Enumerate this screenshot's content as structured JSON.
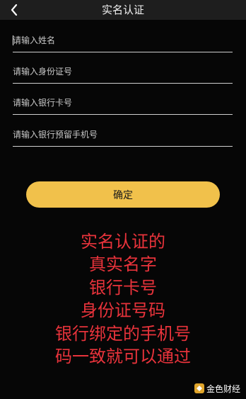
{
  "header": {
    "title": "实名认证"
  },
  "form": {
    "fields": [
      {
        "placeholder": "请输入姓名",
        "value": ""
      },
      {
        "placeholder": "请输入身份证号",
        "value": ""
      },
      {
        "placeholder": "请输入银行卡号",
        "value": ""
      },
      {
        "placeholder": "请输入银行预留手机号",
        "value": ""
      }
    ],
    "confirm_label": "确定"
  },
  "annotation": {
    "lines": [
      "实名认证的",
      "真实名字",
      "银行卡号",
      "身份证号码",
      "银行绑定的手机号",
      "码一致就可以通过"
    ]
  },
  "watermark": {
    "text": "金色财经"
  },
  "colors": {
    "accent": "#f1c14b",
    "annotation": "#e8333b",
    "background": "#000000"
  }
}
